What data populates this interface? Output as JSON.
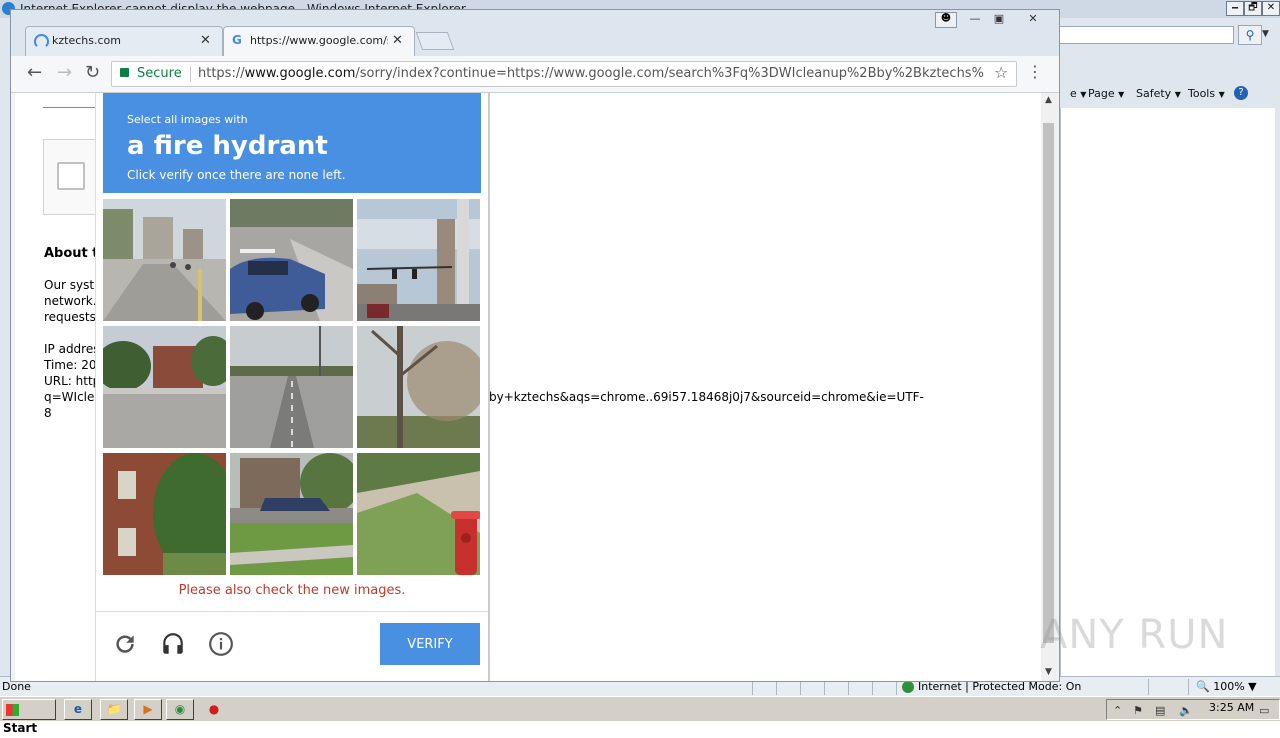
{
  "ie": {
    "title": "Internet Explorer cannot display the webpage - Windows Internet Explorer",
    "window_buttons": [
      "🗕",
      "🗗",
      "✕"
    ],
    "command_bar": [
      {
        "label": "e"
      },
      {
        "label": "Page"
      },
      {
        "label": "Safety"
      },
      {
        "label": "Tools"
      }
    ],
    "status_left": "Done",
    "status_zone": "Internet | Protected Mode: On",
    "zoom": "100%"
  },
  "chrome": {
    "tabs": [
      {
        "title": "kztechs.com"
      },
      {
        "title": "https://www.google.com/se"
      }
    ],
    "secure_label": "Secure",
    "url_scheme": "https://",
    "url_host": "www.google.com",
    "url_rest": "/sorry/index?continue=https://www.google.com/search%3Fq%3DWIcleanup%2Bby%2Bkztechs%2..."
  },
  "page": {
    "about_heading": "About th",
    "body_lines": [
      "Our syst",
      "network.",
      "requests"
    ],
    "info_lines": [
      "IP addres",
      "Time: 20",
      "URL: http",
      "q=WIclea",
      "8"
    ],
    "url_tail": "by+kztechs&aqs=chrome..69i57.18468j0j7&sourceid=chrome&ie=UTF-"
  },
  "captcha": {
    "pre_text": "Select all images with",
    "object": "a fire hydrant",
    "post_text": "Click verify once there are none left.",
    "message": "Please also check the new images.",
    "verify_label": "VERIFY",
    "tiles": [
      {
        "scene": "street-corner-pedestrians"
      },
      {
        "scene": "blue-car-intersection"
      },
      {
        "scene": "traffic-lights-sky"
      },
      {
        "scene": "corner-trees-building"
      },
      {
        "scene": "highway-road"
      },
      {
        "scene": "bare-tree"
      },
      {
        "scene": "brick-house"
      },
      {
        "scene": "house-parked-car"
      },
      {
        "scene": "fire-hydrant-sidewalk"
      }
    ]
  },
  "watermark": "ANY RUN",
  "taskbar": {
    "start_label": "Start",
    "clock": "3:25 AM"
  },
  "colors": {
    "captcha_blue": "#4a90e2",
    "error_red": "#c0392b",
    "secure_green": "#0b8043"
  }
}
